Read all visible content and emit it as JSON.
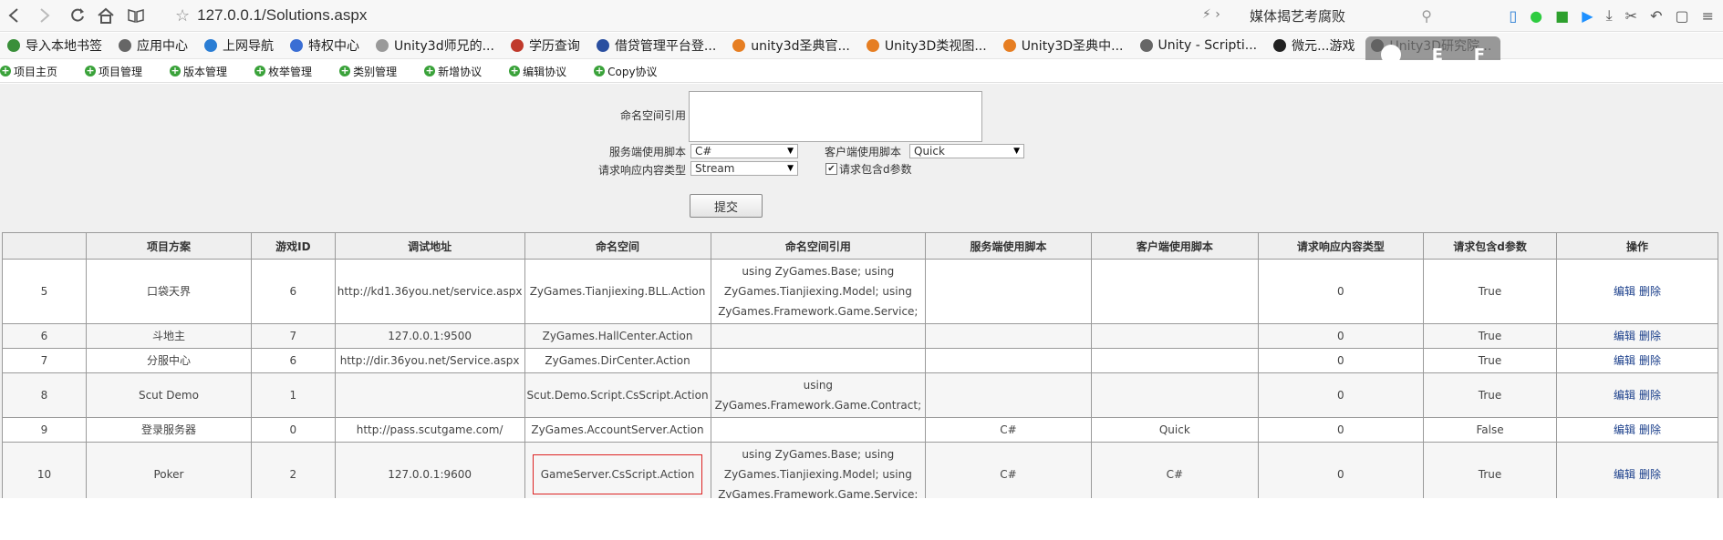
{
  "browser": {
    "url": "127.0.0.1/Solutions.aspx",
    "search_text": "媒体揭艺考腐败"
  },
  "bookmarks": [
    {
      "label": "导入本地书签",
      "color": "#3a8f3a"
    },
    {
      "label": "应用中心",
      "color": "#666666"
    },
    {
      "label": "上网导航",
      "color": "#2a7dd4"
    },
    {
      "label": "特权中心",
      "color": "#3a6ed4"
    },
    {
      "label": "Unity3d师兄的...",
      "color": "#999999"
    },
    {
      "label": "学历查询",
      "color": "#c0392b"
    },
    {
      "label": "借贷管理平台登...",
      "color": "#2a4fa0"
    },
    {
      "label": "unity3d圣典官...",
      "color": "#e67e22"
    },
    {
      "label": "Unity3D类视图...",
      "color": "#e67e22"
    },
    {
      "label": "Unity3D圣典中...",
      "color": "#e67e22"
    },
    {
      "label": "Unity - Scripti...",
      "color": "#666666"
    },
    {
      "label": "微元...游戏",
      "color": "#222222"
    },
    {
      "label": "Unity3D研究院...",
      "color": "#222222"
    }
  ],
  "overlay": {
    "letters": [
      "E",
      "F"
    ]
  },
  "nav": [
    "项目主页",
    "项目管理",
    "版本管理",
    "枚举管理",
    "类别管理",
    "新增协议",
    "编辑协议",
    "Copy协议"
  ],
  "form": {
    "namespace_ref_label": "命名空间引用",
    "server_script_label": "服务端使用脚本",
    "server_script_value": "C#",
    "client_script_label": "客户端使用脚本",
    "client_script_value": "Quick",
    "content_type_label": "请求响应内容类型",
    "content_type_value": "Stream",
    "include_d_label": "请求包含d参数",
    "include_d_checked": true,
    "submit_label": "提交"
  },
  "table": {
    "headers": [
      "",
      "项目方案",
      "游戏ID",
      "调试地址",
      "命名空间",
      "命名空间引用",
      "服务端使用脚本",
      "客户端使用脚本",
      "请求响应内容类型",
      "请求包含d参数",
      "操作"
    ],
    "rows": [
      {
        "id": "5",
        "name": "口袋天界",
        "game_id": "6",
        "debug_url": "http://kd1.36you.net/service.aspx",
        "namespace": "ZyGames.Tianjiexing.BLL.Action",
        "ns_ref": "using ZyGames.Base; using ZyGames.Tianjiexing.Model; using ZyGames.Framework.Game.Service;",
        "server_script": "",
        "client_script": "",
        "content_type": "0",
        "include_d": "True"
      },
      {
        "id": "6",
        "name": "斗地主",
        "game_id": "7",
        "debug_url": "127.0.0.1:9500",
        "namespace": "ZyGames.HallCenter.Action",
        "ns_ref": "",
        "server_script": "",
        "client_script": "",
        "content_type": "0",
        "include_d": "True"
      },
      {
        "id": "7",
        "name": "分服中心",
        "game_id": "6",
        "debug_url": "http://dir.36you.net/Service.aspx",
        "namespace": "ZyGames.DirCenter.Action",
        "ns_ref": "",
        "server_script": "",
        "client_script": "",
        "content_type": "0",
        "include_d": "True"
      },
      {
        "id": "8",
        "name": "Scut Demo",
        "game_id": "1",
        "debug_url": "",
        "namespace": "Scut.Demo.Script.CsScript.Action",
        "ns_ref": "using ZyGames.Framework.Game.Contract;",
        "server_script": "",
        "client_script": "",
        "content_type": "0",
        "include_d": "True"
      },
      {
        "id": "9",
        "name": "登录服务器",
        "game_id": "0",
        "debug_url": "http://pass.scutgame.com/",
        "namespace": "ZyGames.AccountServer.Action",
        "ns_ref": "",
        "server_script": "C#",
        "client_script": "Quick",
        "content_type": "0",
        "include_d": "False"
      },
      {
        "id": "10",
        "name": "Poker",
        "game_id": "2",
        "debug_url": "127.0.0.1:9600",
        "namespace": "GameServer.CsScript.Action",
        "ns_ref": "using ZyGames.Base; using ZyGames.Tianjiexing.Model; using ZyGames.Framework.Game.Service;",
        "server_script": "C#",
        "client_script": "C#",
        "content_type": "0",
        "include_d": "True"
      }
    ],
    "edit_label": "编辑",
    "delete_label": "删除"
  }
}
